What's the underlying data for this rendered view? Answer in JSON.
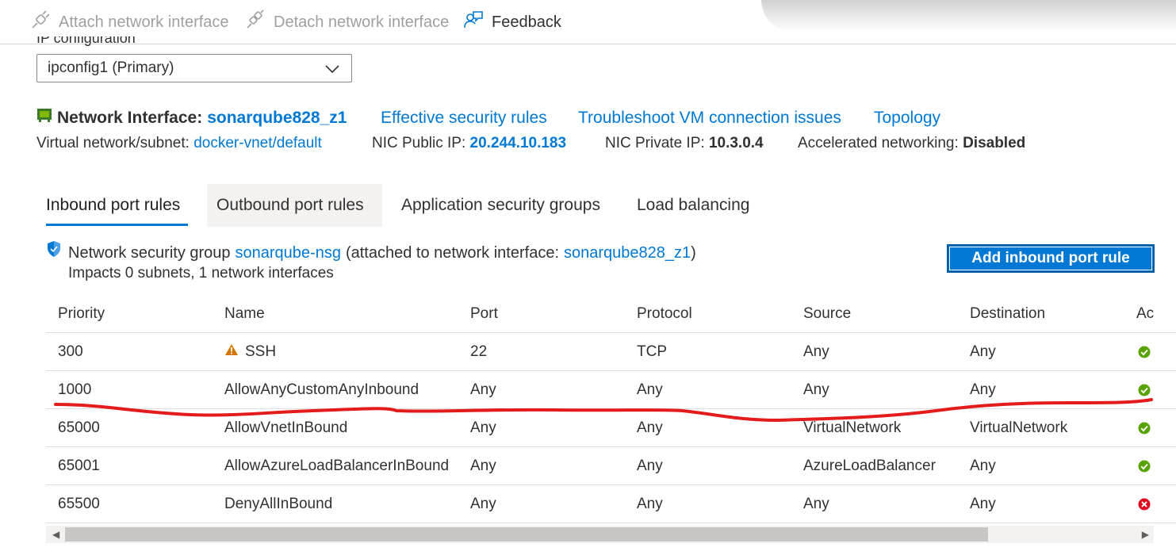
{
  "toolbar": {
    "attach_label": "Attach network interface",
    "detach_label": "Detach network interface",
    "feedback_label": "Feedback"
  },
  "ip_configuration": {
    "label": "IP configuration",
    "selected": "ipconfig1 (Primary)"
  },
  "nic": {
    "label": "Network Interface:",
    "name": "sonarqube828_z1",
    "links": {
      "effective_rules": "Effective security rules",
      "troubleshoot": "Troubleshoot VM connection issues",
      "topology": "Topology"
    },
    "vnet_label": "Virtual network/subnet:",
    "vnet_value": "docker-vnet/default",
    "public_ip_label": "NIC Public IP:",
    "public_ip_value": "20.244.10.183",
    "private_ip_label": "NIC Private IP:",
    "private_ip_value": "10.3.0.4",
    "accel_label": "Accelerated networking:",
    "accel_value": "Disabled"
  },
  "tabs": [
    {
      "label": "Inbound port rules",
      "active": true
    },
    {
      "label": "Outbound port rules",
      "active": false
    },
    {
      "label": "Application security groups",
      "active": false
    },
    {
      "label": "Load balancing",
      "active": false
    }
  ],
  "nsg": {
    "prefix": "Network security group",
    "name": "sonarqube-nsg",
    "attached_prefix": "(attached to network interface:",
    "attached_nic": "sonarqube828_z1",
    "attached_suffix": ")",
    "impacts": "Impacts 0 subnets, 1 network interfaces",
    "add_button": "Add inbound port rule"
  },
  "table": {
    "columns": [
      "Priority",
      "Name",
      "Port",
      "Protocol",
      "Source",
      "Destination",
      "Ac"
    ],
    "rows": [
      {
        "priority": "300",
        "name": "SSH",
        "warning": true,
        "port": "22",
        "protocol": "TCP",
        "source": "Any",
        "destination": "Any",
        "action": "allow"
      },
      {
        "priority": "1000",
        "name": "AllowAnyCustomAnyInbound",
        "warning": false,
        "port": "Any",
        "protocol": "Any",
        "source": "Any",
        "destination": "Any",
        "action": "allow"
      },
      {
        "priority": "65000",
        "name": "AllowVnetInBound",
        "warning": false,
        "port": "Any",
        "protocol": "Any",
        "source": "VirtualNetwork",
        "destination": "VirtualNetwork",
        "action": "allow"
      },
      {
        "priority": "65001",
        "name": "AllowAzureLoadBalancerInBound",
        "warning": false,
        "port": "Any",
        "protocol": "Any",
        "source": "AzureLoadBalancer",
        "destination": "Any",
        "action": "allow"
      },
      {
        "priority": "65500",
        "name": "DenyAllInBound",
        "warning": false,
        "port": "Any",
        "protocol": "Any",
        "source": "Any",
        "destination": "Any",
        "action": "deny"
      }
    ]
  },
  "colors": {
    "link": "#0078d4",
    "allow": "#57a300",
    "deny": "#e00b1c",
    "warning": "#d47500",
    "annotation": "#e31b1b"
  }
}
